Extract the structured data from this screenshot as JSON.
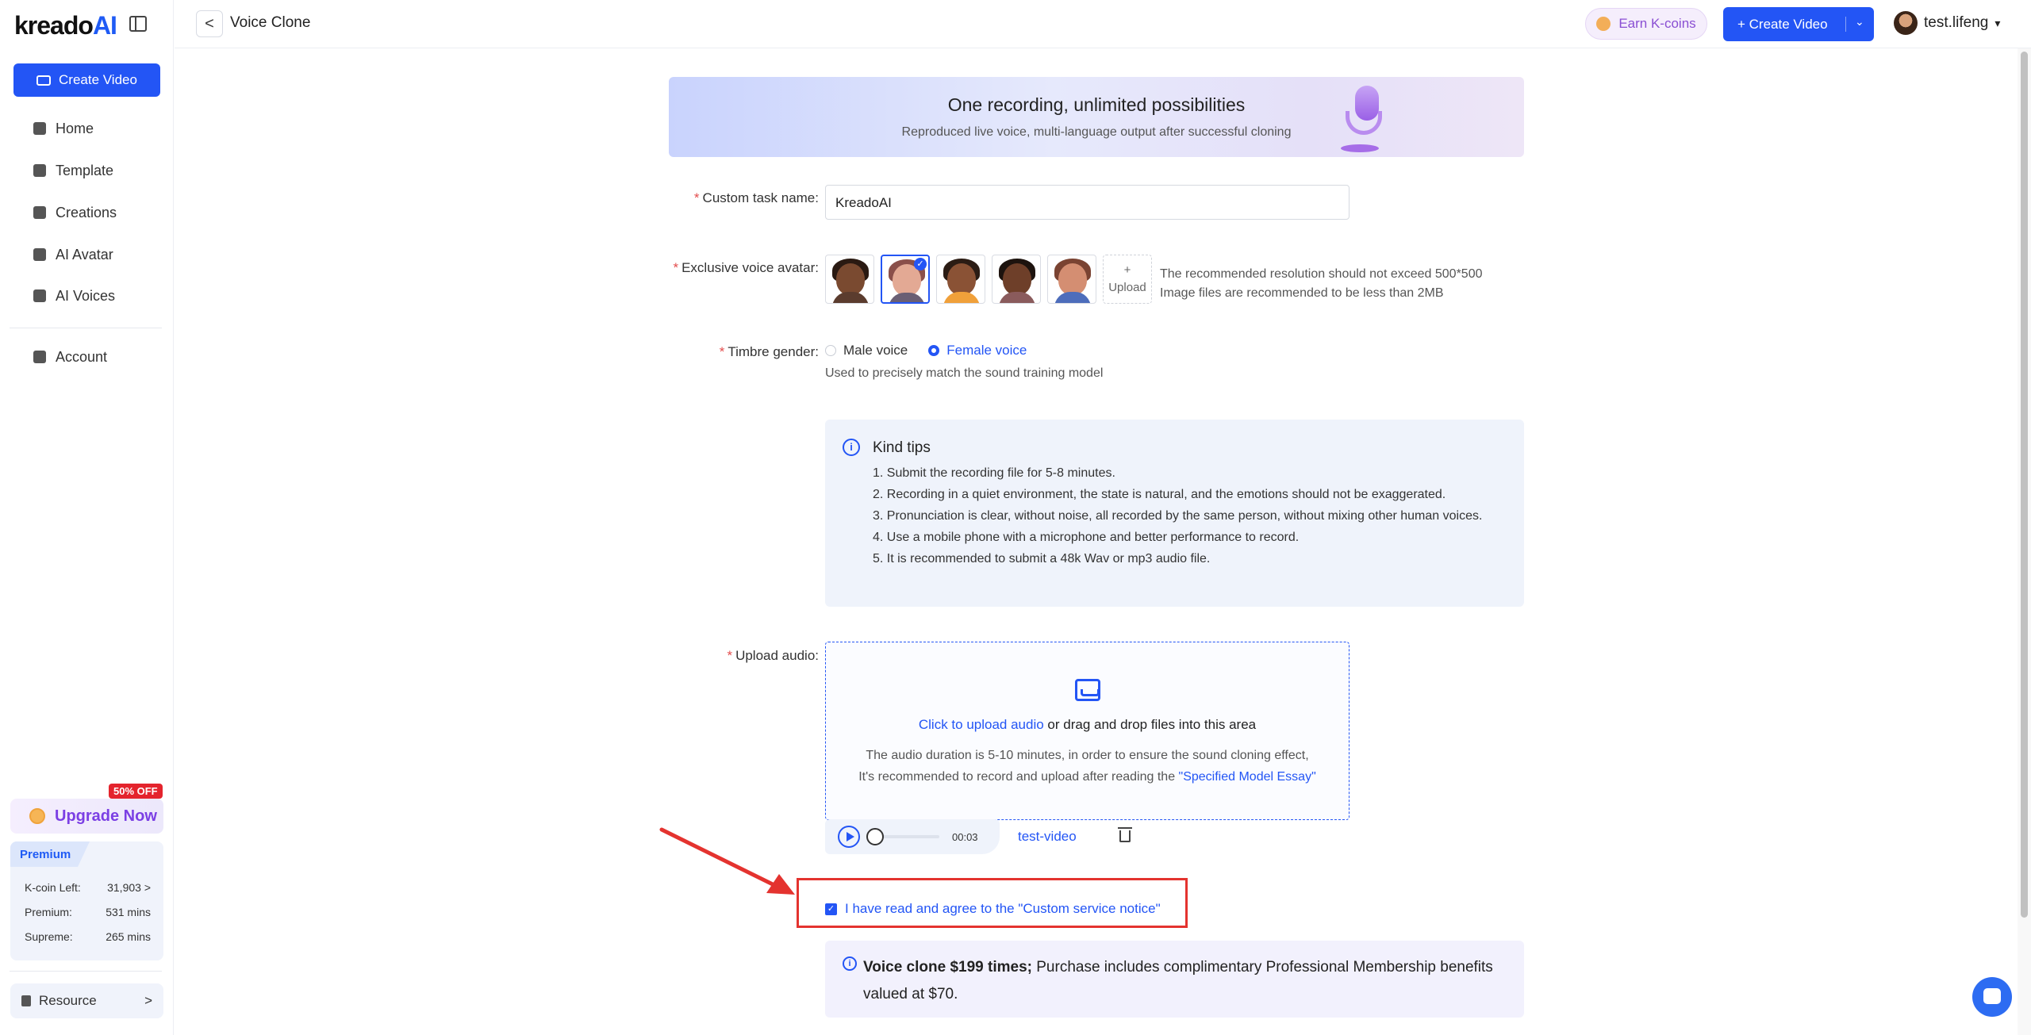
{
  "sidebar": {
    "logo_main": "kreado",
    "logo_ai": "AI",
    "create_video": "Create Video",
    "nav": [
      {
        "label": "Home"
      },
      {
        "label": "Template"
      },
      {
        "label": "Creations"
      },
      {
        "label": "AI Avatar"
      },
      {
        "label": "AI Voices"
      },
      {
        "label": "Account"
      }
    ],
    "upgrade_label": "Upgrade Now",
    "discount_badge": "50% OFF",
    "premium": {
      "tab": "Premium",
      "rows": [
        {
          "label": "K-coin Left:",
          "value": "31,903 >"
        },
        {
          "label": "Premium:",
          "value": "531 mins"
        },
        {
          "label": "Supreme:",
          "value": "265 mins"
        }
      ]
    },
    "resource": "Resource",
    "resource_chevron": ">"
  },
  "header": {
    "back": "<",
    "title": "Voice Clone",
    "earn": "Earn K-coins",
    "create_video": "+ Create Video",
    "create_dropdown": "⌄",
    "username": "test.lifeng",
    "user_dropdown": "▾"
  },
  "banner": {
    "title": "One recording, unlimited possibilities",
    "subtitle": "Reproduced live voice, multi-language output after successful cloning"
  },
  "form": {
    "task_name_label": "Custom task name:",
    "task_name_value": "KreadoAI",
    "avatar_label": "Exclusive voice avatar:",
    "upload_plus": "+",
    "upload_label": "Upload",
    "avatar_hint_1": "The recommended resolution should not exceed 500*500",
    "avatar_hint_2": "Image files are recommended to be less than 2MB",
    "gender_label": "Timbre gender:",
    "gender_options": [
      {
        "label": "Male voice",
        "selected": false
      },
      {
        "label": "Female voice",
        "selected": true
      }
    ],
    "gender_hint": "Used to precisely match the sound training model",
    "upload_label_field": "Upload audio:"
  },
  "tips": {
    "info": "i",
    "title": "Kind tips",
    "items": [
      "1. Submit the recording file for 5-8 minutes.",
      "2. Recording in a quiet environment, the state is natural, and the emotions should not be exaggerated.",
      "3. Pronunciation is clear, without noise, all recorded by the same person, without mixing other human voices.",
      "4. Use a mobile phone with a microphone and better performance to record.",
      "5. It is recommended to submit a 48k Wav or mp3 audio file."
    ]
  },
  "dropzone": {
    "link": "Click to upload audio",
    "rest": " or drag and drop files into this area",
    "line1": "The audio duration is 5-10 minutes, in order to ensure the sound cloning effect,",
    "line2_pre": "It's recommended to record and upload after reading the ",
    "line2_link": "\"Specified Model Essay\""
  },
  "player": {
    "time": "00:03",
    "file_name": "test-video"
  },
  "agreement": {
    "check": "✓",
    "text": "I have read and agree to the \"Custom service notice\""
  },
  "price": {
    "info": "i",
    "bold": "Voice clone $199 times;",
    "rest": " Purchase includes complimentary Professional Membership benefits valued at $70."
  },
  "colors": {
    "primary": "#2355f5",
    "annotation_red": "#e4332f"
  }
}
